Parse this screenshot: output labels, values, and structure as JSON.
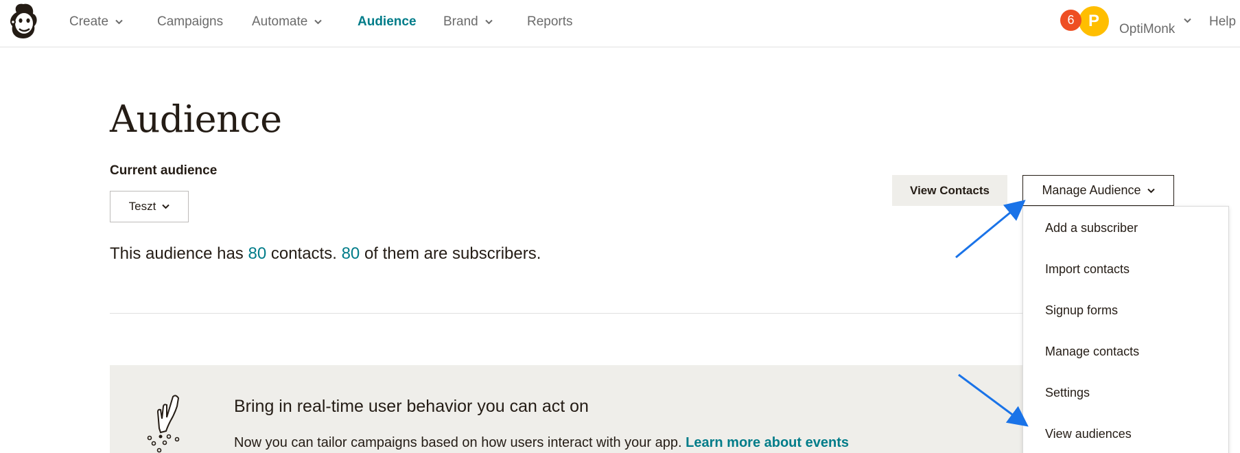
{
  "nav": {
    "items": [
      {
        "label": "Create",
        "has_menu": true
      },
      {
        "label": "Campaigns",
        "has_menu": false
      },
      {
        "label": "Automate",
        "has_menu": true
      },
      {
        "label": "Audience",
        "has_menu": false,
        "active": true
      },
      {
        "label": "Brand",
        "has_menu": true
      },
      {
        "label": "Reports",
        "has_menu": false
      }
    ],
    "notification_count": "6",
    "avatar_initial": "P",
    "account_name": "OptiMonk",
    "help_label": "Help"
  },
  "page": {
    "title": "Audience",
    "current_audience_label": "Current audience",
    "audience_selected": "Teszt",
    "summary": {
      "prefix": "This audience has",
      "contacts": "80",
      "middle": "contacts.",
      "subscribers": "80",
      "suffix": "of them are subscribers."
    },
    "view_contacts_label": "View Contacts",
    "manage_audience_label": "Manage Audience"
  },
  "dropdown": {
    "items": [
      "Add a subscriber",
      "Import contacts",
      "Signup forms",
      "Manage contacts",
      "Settings",
      "View audiences"
    ]
  },
  "banner": {
    "title": "Bring in real-time user behavior you can act on",
    "text": "Now you can tailor campaigns based on how users interact with your app.",
    "link": "Learn more about events"
  },
  "colors": {
    "accent": "#007c89",
    "badge": "#ee4f23",
    "avatar": "#ffbe00",
    "annotation_arrow": "#1a73e8",
    "banner_bg": "#efeeea"
  }
}
